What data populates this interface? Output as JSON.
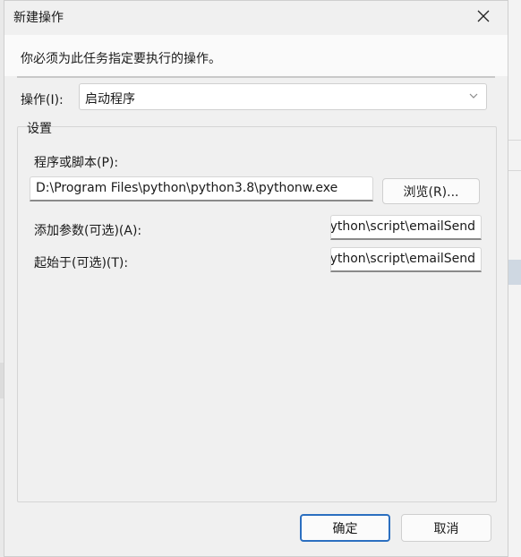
{
  "dialog": {
    "title": "新建操作",
    "instruction": "你必须为此任务指定要执行的操作。",
    "action_label": "操作(I):",
    "action_value": "启动程序",
    "settings_group": "设置",
    "program_label": "程序或脚本(P):",
    "program_value": "D:\\Program Files\\python\\python3.8\\pythonw.exe",
    "browse_label": "浏览(R)...",
    "args_label": "添加参数(可选)(A):",
    "args_value": "ython\\script\\emailSend",
    "start_label": "起始于(可选)(T):",
    "start_value": "ython\\script\\emailSend",
    "ok_label": "确定",
    "cancel_label": "取消"
  },
  "icons": {
    "close": "close-icon",
    "dropdown": "chevron-down-icon"
  }
}
